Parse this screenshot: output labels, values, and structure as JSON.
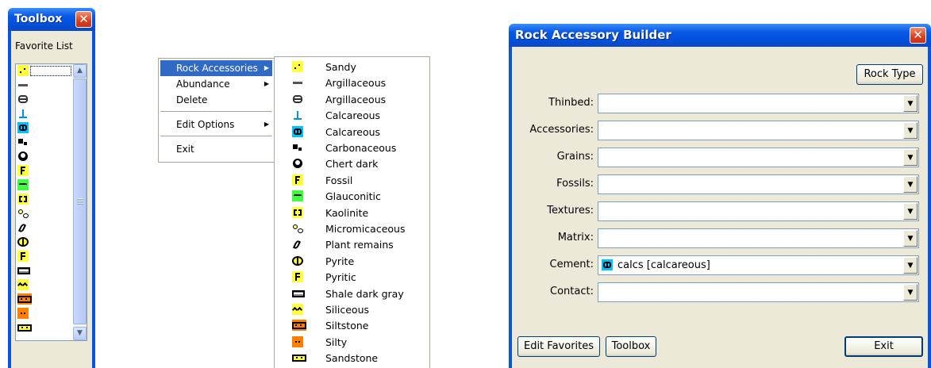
{
  "toolbox": {
    "title": "Toolbox",
    "close": "✕",
    "favorite_label": "Favorite List",
    "scroll_up": "▲",
    "scroll_down": "▼"
  },
  "context_menu": {
    "items": [
      "Rock Accessories",
      "Abundance",
      "Delete",
      "Edit Options",
      "Exit"
    ],
    "arrow": "▶"
  },
  "submenu": {
    "items": [
      {
        "label": "Sandy",
        "icon": "sandy-icon"
      },
      {
        "label": "Argillaceous",
        "icon": "argillaceous-icon"
      },
      {
        "label": "Argillaceous",
        "icon": "argillaceous-alt-icon"
      },
      {
        "label": "Calcareous",
        "icon": "calcareous-icon"
      },
      {
        "label": "Calcareous",
        "icon": "calcareous-alt-icon"
      },
      {
        "label": "Carbonaceous",
        "icon": "carbonaceous-icon"
      },
      {
        "label": "Chert dark",
        "icon": "chert-dark-icon"
      },
      {
        "label": "Fossil",
        "icon": "fossil-icon"
      },
      {
        "label": "Glauconitic",
        "icon": "glauconitic-icon"
      },
      {
        "label": "Kaolinite",
        "icon": "kaolinite-icon"
      },
      {
        "label": "Micromicaceous",
        "icon": "micromicaceous-icon"
      },
      {
        "label": "Plant remains",
        "icon": "plant-remains-icon"
      },
      {
        "label": "Pyrite",
        "icon": "pyrite-icon"
      },
      {
        "label": "Pyritic",
        "icon": "pyritic-icon"
      },
      {
        "label": "Shale dark gray",
        "icon": "shale-dark-gray-icon"
      },
      {
        "label": "Siliceous",
        "icon": "siliceous-icon"
      },
      {
        "label": "Siltstone",
        "icon": "siltstone-icon"
      },
      {
        "label": "Silty",
        "icon": "silty-icon"
      },
      {
        "label": "Sandstone",
        "icon": "sandstone-icon"
      }
    ]
  },
  "builder": {
    "title": "Rock Accessory Builder",
    "close": "✕",
    "rock_type_button": "Rock Type",
    "fields": [
      {
        "label": "Thinbed:",
        "value": ""
      },
      {
        "label": "Accessories:",
        "value": ""
      },
      {
        "label": "Grains:",
        "value": ""
      },
      {
        "label": "Fossils:",
        "value": ""
      },
      {
        "label": "Textures:",
        "value": ""
      },
      {
        "label": "Matrix:",
        "value": ""
      },
      {
        "label": "Cement:",
        "value": "calcs [calcareous]"
      },
      {
        "label": "Contact:",
        "value": ""
      }
    ],
    "dropdown_glyph": "▼",
    "edit_favorites_button": "Edit Favorites",
    "toolbox_button": "Toolbox",
    "exit_button": "Exit"
  },
  "colors": {
    "title_blue": "#0a5ae8",
    "menu_highlight": "#316ac5",
    "dialog_bg": "#ece9d8"
  }
}
